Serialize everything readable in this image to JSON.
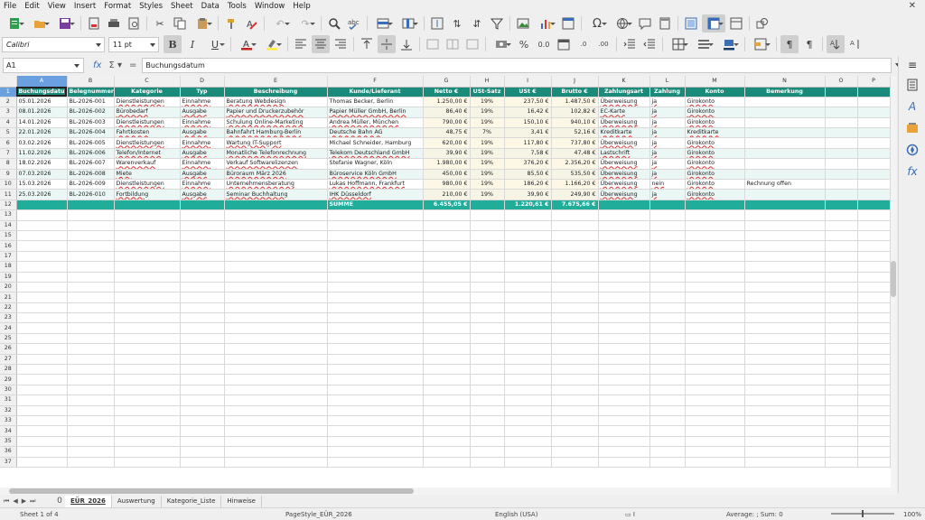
{
  "menu": [
    "File",
    "Edit",
    "View",
    "Insert",
    "Format",
    "Styles",
    "Sheet",
    "Data",
    "Tools",
    "Window",
    "Help"
  ],
  "toolbar": {
    "font_name": "Calibri",
    "font_size": "11 pt"
  },
  "formula": {
    "cell_ref": "A1",
    "content": "Buchungsdatum"
  },
  "columns": [
    "A",
    "B",
    "C",
    "D",
    "E",
    "F",
    "G",
    "H",
    "I",
    "J",
    "K",
    "L",
    "M",
    "N",
    "O",
    "P"
  ],
  "header_row": [
    "Buchungsdatum",
    "Belegnummer",
    "Kategorie",
    "Typ",
    "Beschreibung",
    "Kunde/Lieferant",
    "Netto €",
    "USt-Satz",
    "USt €",
    "Brutto €",
    "Zahlungsart",
    "Zahlung",
    "Konto",
    "Bemerkung"
  ],
  "rows": [
    [
      "05.01.2026",
      "BL-2026-001",
      "Dienstleistungen",
      "Einnahme",
      "Beratung Webdesign",
      "Thomas Becker, Berlin",
      "1.250,00 €",
      "19%",
      "237,50 €",
      "1.487,50 €",
      "Überweisung",
      "ja",
      "Girokonto",
      ""
    ],
    [
      "08.01.2026",
      "BL-2026-002",
      "Bürobedarf",
      "Ausgabe",
      "Papier und Druckerzubehör",
      "Papier Müller GmbH, Berlin",
      "86,40 €",
      "19%",
      "16,42 €",
      "102,82 €",
      "EC-Karte",
      "ja",
      "Girokonto",
      ""
    ],
    [
      "14.01.2026",
      "BL-2026-003",
      "Dienstleistungen",
      "Einnahme",
      "Schulung Online-Marketing",
      "Andrea Müller, München",
      "790,00 €",
      "19%",
      "150,10 €",
      "940,10 €",
      "Überweisung",
      "ja",
      "Girokonto",
      ""
    ],
    [
      "22.01.2026",
      "BL-2026-004",
      "Fahrtkosten",
      "Ausgabe",
      "Bahnfahrt Hamburg-Berlin",
      "Deutsche Bahn AG",
      "48,75 €",
      "7%",
      "3,41 €",
      "52,16 €",
      "Kreditkarte",
      "ja",
      "Kreditkarte",
      ""
    ],
    [
      "03.02.2026",
      "BL-2026-005",
      "Dienstleistungen",
      "Einnahme",
      "Wartung IT-Support",
      "Michael Schneider, Hamburg",
      "620,00 €",
      "19%",
      "117,80 €",
      "737,80 €",
      "Überweisung",
      "ja",
      "Girokonto",
      ""
    ],
    [
      "11.02.2026",
      "BL-2026-006",
      "Telefon/Internet",
      "Ausgabe",
      "Monatliche Telefonrechnung",
      "Telekom Deutschland GmbH",
      "39,90 €",
      "19%",
      "7,58 €",
      "47,48 €",
      "Lastschrift",
      "ja",
      "Girokonto",
      ""
    ],
    [
      "18.02.2026",
      "BL-2026-007",
      "Warenverkauf",
      "Einnahme",
      "Verkauf Softwarelizenzen",
      "Stefanie Wagner, Köln",
      "1.980,00 €",
      "19%",
      "376,20 €",
      "2.356,20 €",
      "Überweisung",
      "ja",
      "Girokonto",
      ""
    ],
    [
      "07.03.2026",
      "BL-2026-008",
      "Miete",
      "Ausgabe",
      "Büroraum März 2026",
      "Büroservice Köln GmbH",
      "450,00 €",
      "19%",
      "85,50 €",
      "535,50 €",
      "Überweisung",
      "ja",
      "Girokonto",
      ""
    ],
    [
      "15.03.2026",
      "BL-2026-009",
      "Dienstleistungen",
      "Einnahme",
      "Unternehmensberatung",
      "Lukas Hoffmann, Frankfurt",
      "980,00 €",
      "19%",
      "186,20 €",
      "1.166,20 €",
      "Überweisung",
      "nein",
      "Girokonto",
      "Rechnung offen"
    ],
    [
      "25.03.2026",
      "BL-2026-010",
      "Fortbildung",
      "Ausgabe",
      "Seminar Buchhaltung",
      "IHK Düsseldorf",
      "210,00 €",
      "19%",
      "39,90 €",
      "249,90 €",
      "Überweisung",
      "ja",
      "Girokonto",
      ""
    ]
  ],
  "sum_row": {
    "label": "SUMME",
    "netto": "6.455,05 €",
    "ust": "1.220,61 €",
    "brutto": "7.675,66 €"
  },
  "total_rows": 37,
  "sheet_tabs": [
    "EÜR_2026",
    "Auswertung",
    "Kategorie_Liste",
    "Hinweise"
  ],
  "active_tab": "EÜR_2026",
  "tab_marker": "0",
  "status": {
    "sheet": "Sheet 1 of 4",
    "page_style": "PageStyle_EÜR_2026",
    "language": "English (USA)",
    "summary": "Average: ; Sum: 0",
    "zoom": "100%"
  },
  "colors": {
    "header_bg": "#1a8a7a",
    "sum_bg": "#20ae9b",
    "selection": "#6aa0e0"
  }
}
